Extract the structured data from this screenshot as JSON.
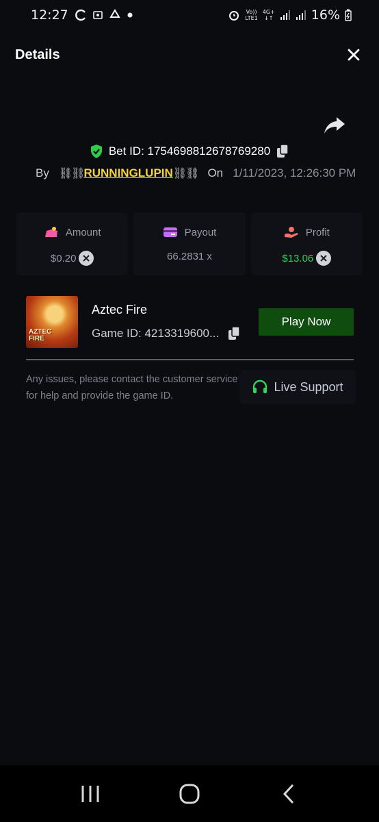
{
  "status_bar": {
    "time": "12:27",
    "battery": "16%",
    "icons": [
      "sync-icon",
      "photo-icon",
      "recycle-icon",
      "dot-icon",
      "alarm-icon",
      "volte-icon",
      "4g-icon",
      "signal-icon",
      "signal2-icon",
      "battery-icon"
    ],
    "network_top": "Vo))",
    "network_bottom": "LTE1",
    "network_type": "4G+"
  },
  "header": {
    "title": "Details",
    "close_icon": "close-icon"
  },
  "share_icon": "share-icon",
  "bet": {
    "bet_id": "Bet ID: 1754698812678769280",
    "by_label": "By",
    "username": "RUNNINGLUPIN",
    "chain_left": "⛓⛓",
    "chain_right": "⛓⛓",
    "on_label": "On",
    "date": "1/11/2023, 12:26:30 PM"
  },
  "stats": [
    {
      "label": "Amount",
      "value": "$0.20",
      "icon": "amount-icon"
    },
    {
      "label": "Payout",
      "value": "66.2831 x",
      "icon": "payout-card-icon"
    },
    {
      "label": "Profit",
      "value": "$13.06",
      "icon": "profit-hand-icon"
    }
  ],
  "game": {
    "name": "Aztec Fire",
    "game_id": "Game ID: 4213319600...",
    "thumb_line1": "AZTEC",
    "thumb_line2": "FIRE",
    "play_label": "Play Now"
  },
  "help": {
    "text": "Any issues, please contact the customer service for help and provide the game ID.",
    "support_label": "Live Support"
  },
  "colors": {
    "background": "#0b0c10",
    "username": "#f6d23b",
    "profit": "#34d05a",
    "play_button": "#0f4d0f",
    "shield": "#2ecc4a",
    "support_icon": "#35d35a"
  }
}
